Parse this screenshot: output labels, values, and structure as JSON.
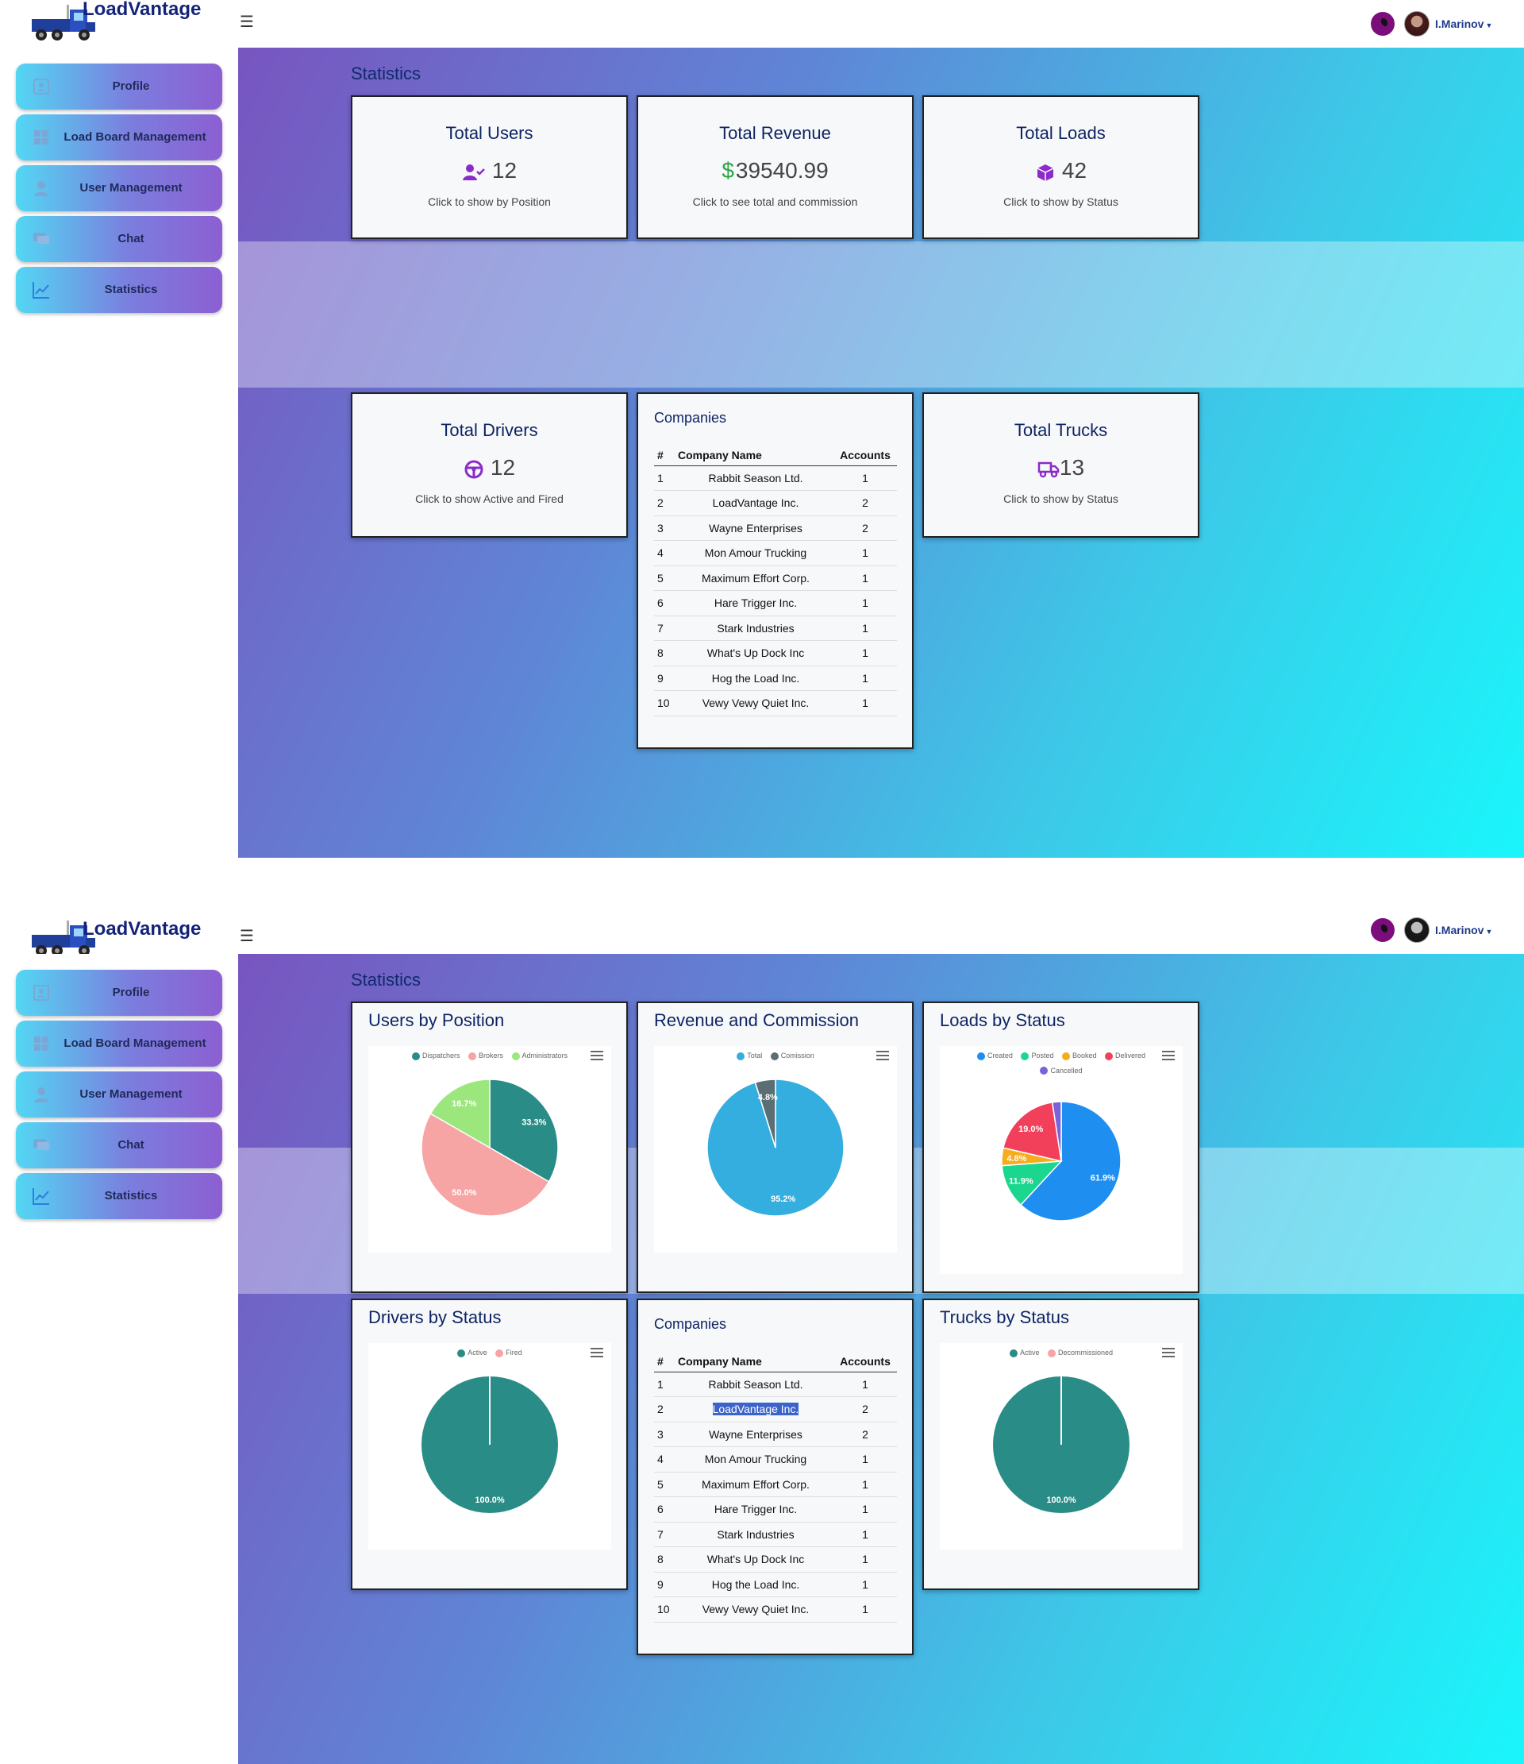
{
  "brand": "LoadVantage",
  "user": {
    "name": "I.Marinov"
  },
  "sidebar": {
    "items": [
      {
        "label": "Profile",
        "icon": "profile-icon"
      },
      {
        "label": "Load Board Management",
        "icon": "dashboard-icon"
      },
      {
        "label": "User Management",
        "icon": "user-icon"
      },
      {
        "label": "Chat",
        "icon": "chat-icon"
      },
      {
        "label": "Statistics",
        "icon": "chart-line-icon"
      }
    ]
  },
  "section_title": "Statistics",
  "stats": {
    "users": {
      "title": "Total Users",
      "value": "12",
      "sub": "Click to show by Position",
      "icon": "user-check-icon"
    },
    "revenue": {
      "title": "Total Revenue",
      "value": "39540.99",
      "currency": "$",
      "sub": "Click to see total and commission"
    },
    "loads": {
      "title": "Total Loads",
      "value": "42",
      "sub": "Click to show by Status",
      "icon": "box-icon"
    },
    "drivers": {
      "title": "Total Drivers",
      "value": "12",
      "sub": "Click to show Active and Fired",
      "icon": "steering-wheel-icon"
    },
    "trucks": {
      "title": "Total Trucks",
      "value": "13",
      "sub": "Click to show by Status",
      "icon": "truck-icon"
    }
  },
  "companies": {
    "title": "Companies",
    "headers": [
      "#",
      "Company Name",
      "Accounts"
    ],
    "rows": [
      [
        "1",
        "Rabbit Season Ltd.",
        "1"
      ],
      [
        "2",
        "LoadVantage Inc.",
        "2"
      ],
      [
        "3",
        "Wayne Enterprises",
        "2"
      ],
      [
        "4",
        "Mon Amour Trucking",
        "1"
      ],
      [
        "5",
        "Maximum Effort Corp.",
        "1"
      ],
      [
        "6",
        "Hare Trigger Inc.",
        "1"
      ],
      [
        "7",
        "Stark Industries",
        "1"
      ],
      [
        "8",
        "What's Up Dock Inc",
        "1"
      ],
      [
        "9",
        "Hog the Load Inc.",
        "1"
      ],
      [
        "10",
        "Vewy Vewy Quiet Inc.",
        "1"
      ]
    ]
  },
  "charts": {
    "users_by_position": {
      "title": "Users by Position"
    },
    "revenue_commission": {
      "title": "Revenue and Commission"
    },
    "loads_by_status": {
      "title": "Loads by Status"
    },
    "drivers_by_status": {
      "title": "Drivers by Status"
    },
    "trucks_by_status": {
      "title": "Trucks by Status"
    }
  },
  "chart_data": [
    {
      "type": "pie",
      "title": "Users by Position",
      "categories": [
        "Dispatchers",
        "Brokers",
        "Administrators"
      ],
      "values": [
        33.3,
        50.0,
        16.7
      ],
      "labels": [
        "33.3%",
        "50.0%",
        "16.7%"
      ],
      "colors": [
        "#2a8c87",
        "#f7a4a4",
        "#9be77d"
      ]
    },
    {
      "type": "pie",
      "title": "Revenue and Commission",
      "categories": [
        "Total",
        "Comission"
      ],
      "values": [
        95.2,
        4.8
      ],
      "labels": [
        "95.2%",
        "4.8%"
      ],
      "colors": [
        "#33aedf",
        "#5b6e73"
      ]
    },
    {
      "type": "pie",
      "title": "Loads by Status",
      "categories": [
        "Created",
        "Posted",
        "Booked",
        "Delivered",
        "Cancelled"
      ],
      "values": [
        61.9,
        11.9,
        4.8,
        19.0,
        2.4
      ],
      "labels": [
        "61.9%",
        "11.9%",
        "4.8%",
        "19.0%",
        ""
      ],
      "colors": [
        "#1e8ef0",
        "#1bd68e",
        "#f6ac1b",
        "#f2405b",
        "#7c62d8"
      ]
    },
    {
      "type": "pie",
      "title": "Drivers by Status",
      "categories": [
        "Active",
        "Fired"
      ],
      "values": [
        100.0,
        0
      ],
      "labels": [
        "100.0%",
        ""
      ],
      "colors": [
        "#2a8c87",
        "#f7a4a4"
      ]
    },
    {
      "type": "pie",
      "title": "Trucks by Status",
      "categories": [
        "Active",
        "Decommissioned"
      ],
      "values": [
        100.0,
        0
      ],
      "labels": [
        "100.0%",
        ""
      ],
      "colors": [
        "#2a8c87",
        "#f7a4a4"
      ]
    }
  ],
  "colors": {
    "brand": "#14237a",
    "title": "#0d2463",
    "accent_purple": "#8b2bc9",
    "accent_green": "#28a745"
  }
}
